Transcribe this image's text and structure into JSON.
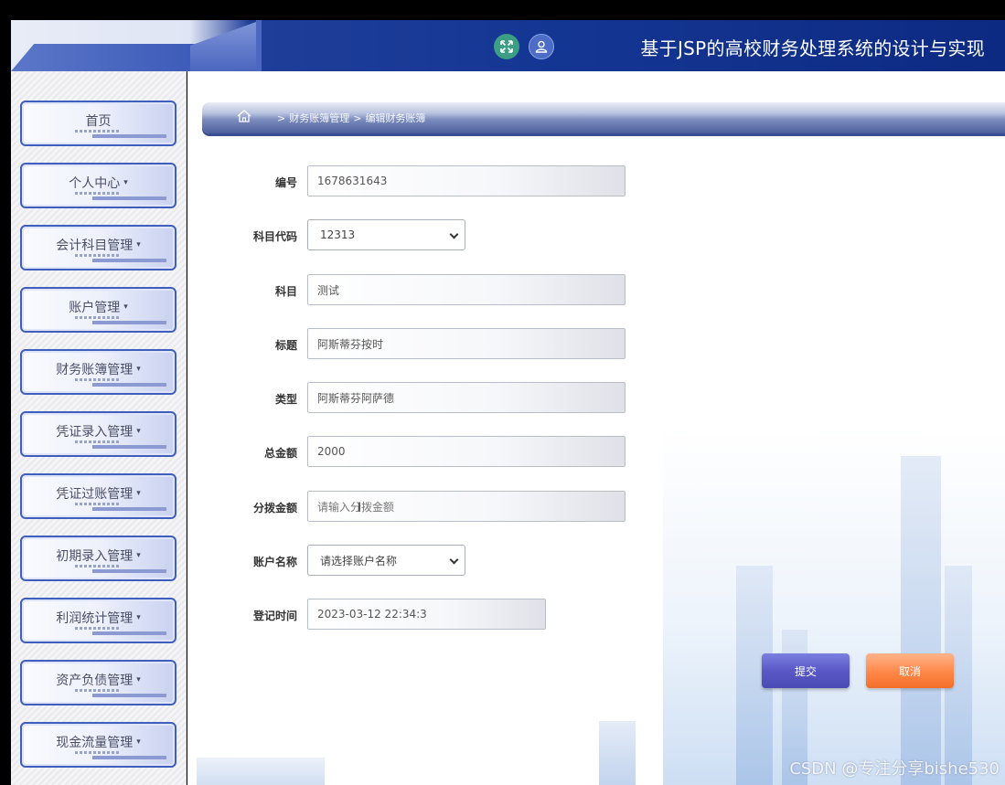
{
  "header": {
    "title": "基于JSP的高校财务处理系统的设计与实现",
    "icons": [
      "fullscreen-icon",
      "user-icon"
    ]
  },
  "sidebar": {
    "items": [
      {
        "label": "首页",
        "has_caret": false
      },
      {
        "label": "个人中心",
        "has_caret": true
      },
      {
        "label": "会计科目管理",
        "has_caret": true
      },
      {
        "label": "账户管理",
        "has_caret": true
      },
      {
        "label": "财务账簿管理",
        "has_caret": true
      },
      {
        "label": "凭证录入管理",
        "has_caret": true
      },
      {
        "label": "凭证过账管理",
        "has_caret": true
      },
      {
        "label": "初期录入管理",
        "has_caret": true
      },
      {
        "label": "利润统计管理",
        "has_caret": true
      },
      {
        "label": "资产负债管理",
        "has_caret": true
      },
      {
        "label": "现金流量管理",
        "has_caret": true
      }
    ],
    "caret": "▾"
  },
  "breadcrumb": {
    "sep": ">",
    "items": [
      "财务账簿管理",
      "编辑财务账簿"
    ]
  },
  "form": {
    "fields": [
      {
        "label": "编号",
        "type": "input",
        "value": "1678631643"
      },
      {
        "label": "科目代码",
        "type": "select",
        "value": "12313"
      },
      {
        "label": "科目",
        "type": "input",
        "value": "测试"
      },
      {
        "label": "标题",
        "type": "input",
        "value": "阿斯蒂芬按时"
      },
      {
        "label": "类型",
        "type": "input",
        "value": "阿斯蒂芬阿萨德"
      },
      {
        "label": "总金额",
        "type": "input",
        "value": "2000"
      },
      {
        "label": "分拨金额",
        "type": "input",
        "value": "",
        "placeholder": "请输入分拨金额"
      },
      {
        "label": "账户名称",
        "type": "select",
        "value": "请选择账户名称"
      },
      {
        "label": "登记时间",
        "type": "input",
        "value": "2023-03-12 22:34:3"
      }
    ],
    "submit_label": "提交",
    "cancel_label": "取消"
  },
  "watermark": "CSDN @专注分享bishe530",
  "colors": {
    "header_blue": "#143693",
    "menu_border": "#3f5fbe",
    "submit": "#5a58c6",
    "cancel": "#ff8748"
  }
}
